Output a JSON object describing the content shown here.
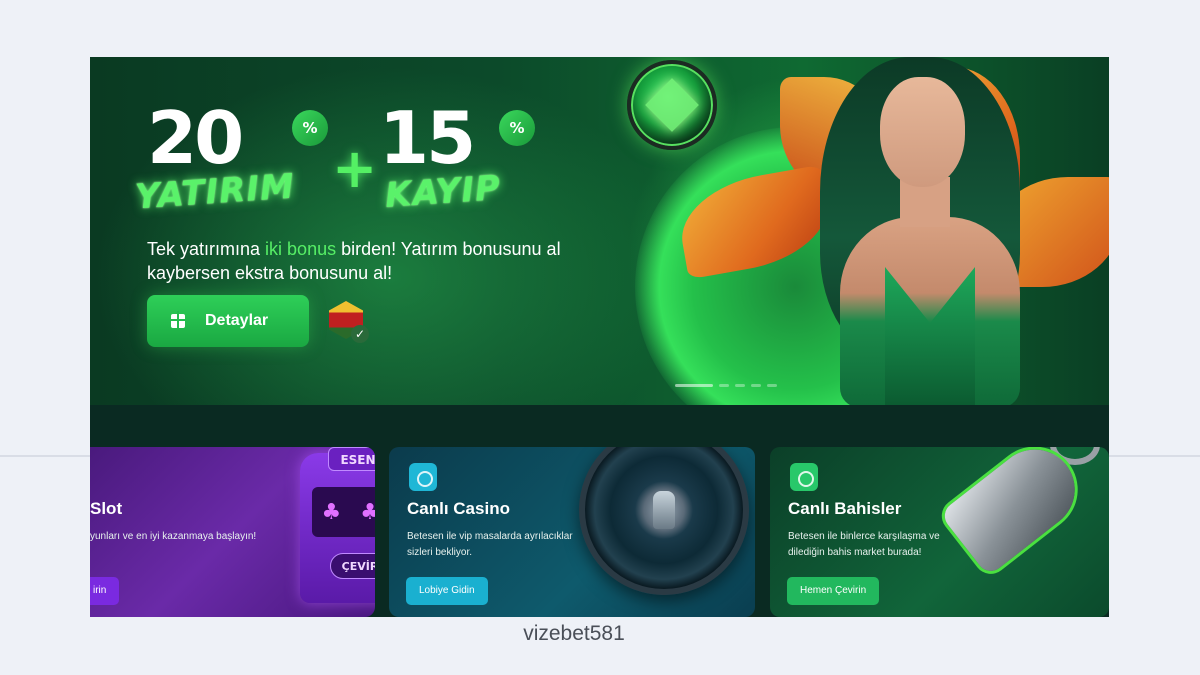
{
  "hero": {
    "num1": "20",
    "pct1": "%",
    "plus": "+",
    "num2": "15",
    "pct2": "%",
    "script1": "YATIRIM",
    "script2": "KAYIP",
    "desc_part1": "Tek yatırımına ",
    "desc_highlight": "iki bonus",
    "desc_part2": " birden! Yatırım bonusunu al kaybersen ekstra bonusunu al!",
    "button_label": "Detaylar",
    "button_icon": "gift-icon",
    "badge_icon": "license-badge-icon",
    "accent_color": "#2ecf58",
    "carousel_pages": 5,
    "carousel_active": 1
  },
  "cards": [
    {
      "title": "Slot",
      "desc": "yunları ve en iyi kazanmaya başlayın!",
      "button": "irin",
      "machine_sign": "ESEN",
      "machine_button": "ÇEVİR",
      "color": "#7a2ae0"
    },
    {
      "title": "Canlı Casino",
      "desc": "Betesen ile vip masalarda ayrılacıklar sizleri bekliyor.",
      "button": "Lobiye Gidin",
      "icon": "casino-chip-icon",
      "color": "#1ab0d0"
    },
    {
      "title": "Canlı Bahisler",
      "desc": "Betesen ile binlerce karşılaşma ve dilediğin bahis market burada!",
      "button": "Hemen Çevirin",
      "icon": "sports-icon",
      "color": "#22b85e"
    }
  ],
  "caption": "vizebet581"
}
